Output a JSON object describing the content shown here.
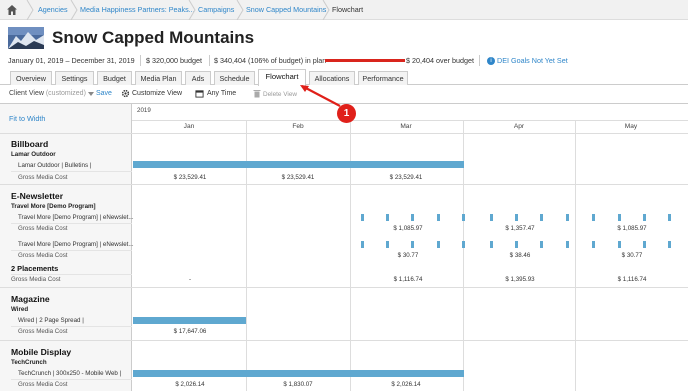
{
  "breadcrumb": {
    "items": [
      "Agencies",
      "Media Happiness Partners: Peaks...",
      "Campaigns",
      "Snow Capped Mountains",
      "Flowchart"
    ]
  },
  "header": {
    "title": "Snow Capped Mountains",
    "date_range": "January 01, 2019 – December 31, 2019",
    "budget": "$ 320,000 budget",
    "in_plan": "$ 340,404 (106% of budget) in plan",
    "over_budget": "$ 20,404 over budget",
    "dei": "DEI Goals Not Yet Set",
    "info_glyph": "i"
  },
  "tabs": [
    "Overview",
    "Settings",
    "Budget",
    "Media Plan",
    "Ads",
    "Schedule",
    "Flowchart",
    "Allocations",
    "Performance"
  ],
  "active_tab": "Flowchart",
  "toolbar": {
    "client_view": "Client View",
    "customized": "(customized)",
    "save": "Save",
    "customize_view": "Customize View",
    "any_time": "Any Time",
    "delete_view": "Delete View"
  },
  "callout": "1",
  "gantt": {
    "fit_to_width": "Fit to Width",
    "year": "2019",
    "months": [
      "Jan",
      "Feb",
      "Mar",
      "Apr",
      "May"
    ],
    "sections": {
      "billboard": {
        "title": "Billboard",
        "vendor": "Lamar Outdoor",
        "item": "Lamar Outdoor | Bulletins |",
        "cost_label": "Gross Media Cost",
        "costs": [
          "$ 23,529.41",
          "$ 23,529.41",
          "$ 23,529.41"
        ]
      },
      "enews": {
        "title": "E-Newsletter",
        "vendor": "Travel More [Demo Program]",
        "item1": "Travel More [Demo Program] | eNewslet...",
        "cost_label1": "Gross Media Cost",
        "costs1": [
          "$ 1,085.97",
          "$ 1,357.47",
          "$ 1,085.97"
        ],
        "item2": "Travel More [Demo Program] | eNewslet...",
        "cost_label2": "Gross Media Cost",
        "costs2": [
          "$ 30.77",
          "$ 38.46",
          "$ 30.77"
        ],
        "placements": "2 Placements",
        "total_label": "Gross Media Cost",
        "totals": [
          "-",
          "$ 1,116.74",
          "$ 1,395.93",
          "$ 1,116.74"
        ]
      },
      "magazine": {
        "title": "Magazine",
        "vendor": "Wired",
        "item": "Wired | 2 Page Spread |",
        "cost_label": "Gross Media Cost",
        "costs": [
          "$ 17,647.06"
        ]
      },
      "mobile": {
        "title": "Mobile Display",
        "vendor": "TechCrunch",
        "item": "TechCrunch | 300x250 - Mobile Web |",
        "cost_label": "Gross Media Cost",
        "costs": [
          "$ 2,026.14",
          "$ 1,830.07",
          "$ 2,026.14"
        ]
      }
    }
  },
  "colors": {
    "accent": "#2f86c9",
    "bar": "#5fa8d0",
    "callout": "#e0201a"
  }
}
